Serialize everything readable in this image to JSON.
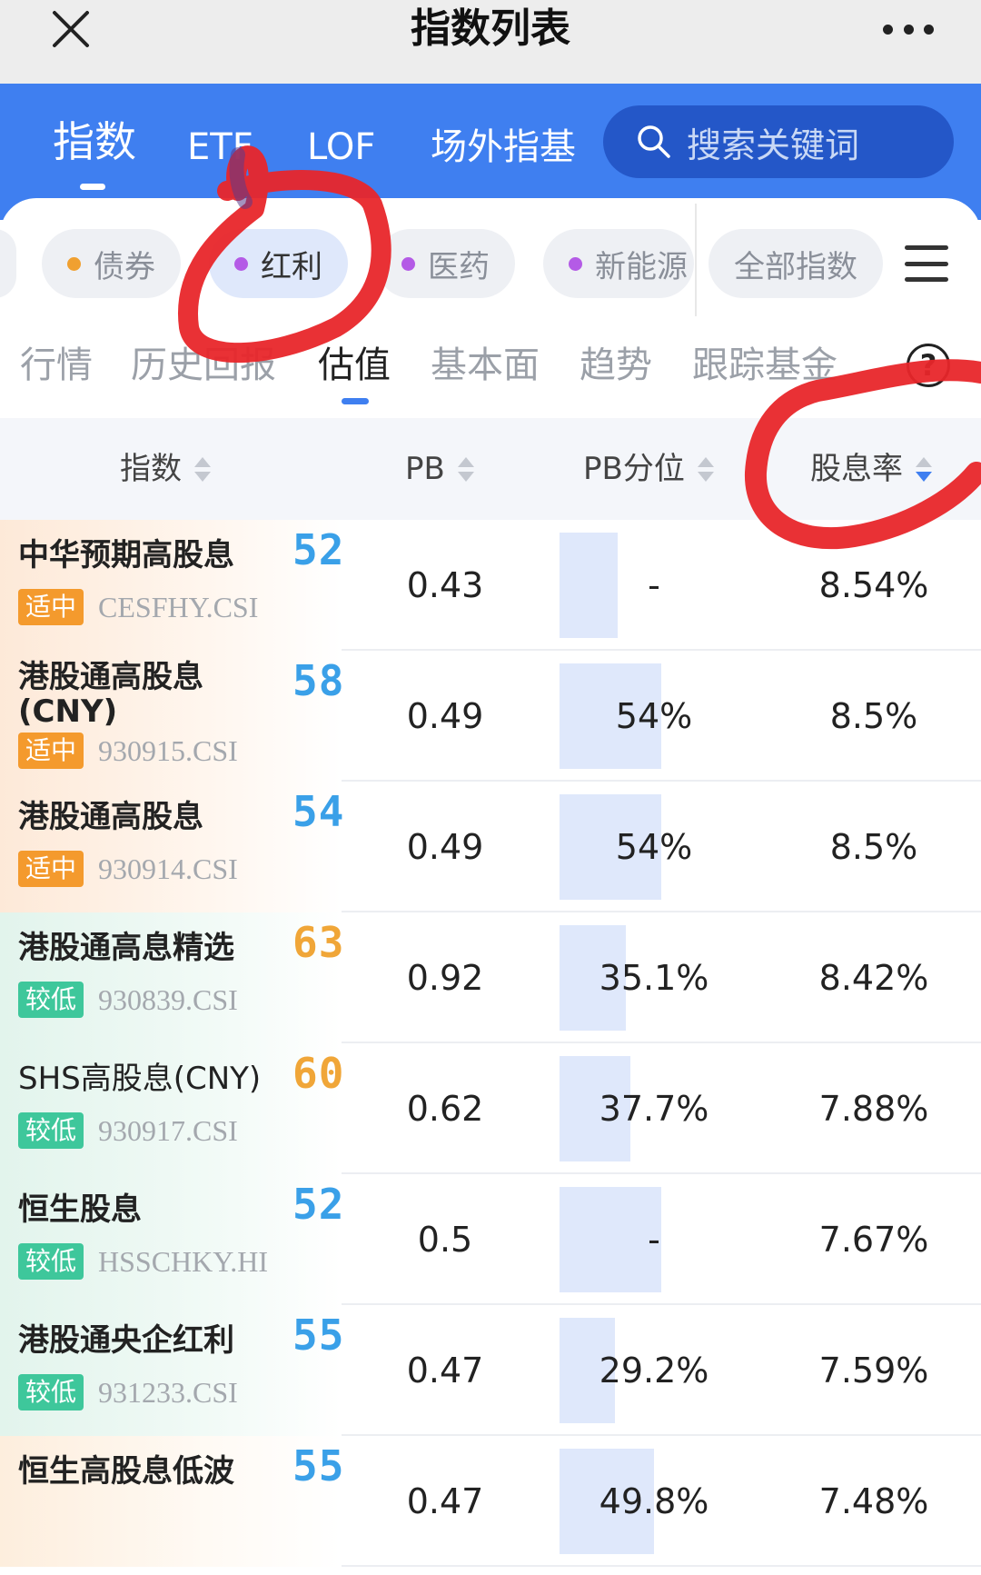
{
  "window": {
    "title": "指数列表"
  },
  "top_tabs": [
    {
      "label": "指数",
      "active": true
    },
    {
      "label": "ETF",
      "active": false
    },
    {
      "label": "LOF",
      "active": false
    },
    {
      "label": "场外指基",
      "active": false
    }
  ],
  "search": {
    "placeholder": "搜索关键词"
  },
  "category_chips": [
    {
      "label": "债券",
      "dot_color": "#f0a030",
      "active": false
    },
    {
      "label": "红利",
      "dot_color": "#b45be6",
      "active": true
    },
    {
      "label": "医药",
      "dot_color": "#b45be6",
      "active": false
    },
    {
      "label": "新能源",
      "dot_color": "#b45be6",
      "active": false
    },
    {
      "label": "全部指数",
      "active": false
    }
  ],
  "sub_tabs": [
    {
      "label": "行情",
      "active": false
    },
    {
      "label": "历史回报",
      "active": false
    },
    {
      "label": "估值",
      "active": true
    },
    {
      "label": "基本面",
      "active": false
    },
    {
      "label": "趋势",
      "active": false
    },
    {
      "label": "跟踪基金",
      "active": false
    }
  ],
  "help_label": "?",
  "table": {
    "headers": {
      "name": "指数",
      "pb": "PB",
      "pb_percentile": "PB分位",
      "dividend_yield": "股息率"
    },
    "sort": {
      "column": "dividend_yield",
      "direction": "desc"
    },
    "rows": [
      {
        "name": "中华预期高股息",
        "tag": "适中",
        "code": "CESFHY.CSI",
        "score": "52",
        "pb": "0.43",
        "pb_percentile": "-",
        "pb_percentile_fill": 0.31,
        "dividend_yield": "8.54%"
      },
      {
        "name": "港股通高股息(CNY)",
        "tag": "适中",
        "code": "930915.CSI",
        "score": "58",
        "pb": "0.49",
        "pb_percentile": "54%",
        "pb_percentile_fill": 0.54,
        "dividend_yield": "8.5%"
      },
      {
        "name": "港股通高股息",
        "tag": "适中",
        "code": "930914.CSI",
        "score": "54",
        "pb": "0.49",
        "pb_percentile": "54%",
        "pb_percentile_fill": 0.54,
        "dividend_yield": "8.5%"
      },
      {
        "name": "港股通高息精选",
        "tag": "较低",
        "code": "930839.CSI",
        "score": "63",
        "pb": "0.92",
        "pb_percentile": "35.1%",
        "pb_percentile_fill": 0.351,
        "dividend_yield": "8.42%"
      },
      {
        "name": "SHS高股息(CNY)",
        "tag": "较低",
        "code": "930917.CSI",
        "score": "60",
        "pb": "0.62",
        "pb_percentile": "37.7%",
        "pb_percentile_fill": 0.377,
        "dividend_yield": "7.88%"
      },
      {
        "name": "恒生股息",
        "tag": "较低",
        "code": "HSSCHKY.HI",
        "score": "52",
        "pb": "0.5",
        "pb_percentile": "-",
        "pb_percentile_fill": 0.54,
        "dividend_yield": "7.67%"
      },
      {
        "name": "港股通央企红利",
        "tag": "较低",
        "code": "931233.CSI",
        "score": "55",
        "pb": "0.47",
        "pb_percentile": "29.2%",
        "pb_percentile_fill": 0.292,
        "dividend_yield": "7.59%"
      },
      {
        "name": "恒生高股息低波",
        "tag": "",
        "code": "",
        "score": "55",
        "pb": "0.47",
        "pb_percentile": "49.8%",
        "pb_percentile_fill": 0.498,
        "dividend_yield": "7.48%"
      }
    ]
  },
  "colors": {
    "brand_blue": "#3f7ff0",
    "tag_mid": "#f49a2d",
    "tag_low": "#3ec79b",
    "score_blue": "#3aa0e8",
    "score_orange": "#f0a638",
    "annotation_red": "#e8262a"
  }
}
